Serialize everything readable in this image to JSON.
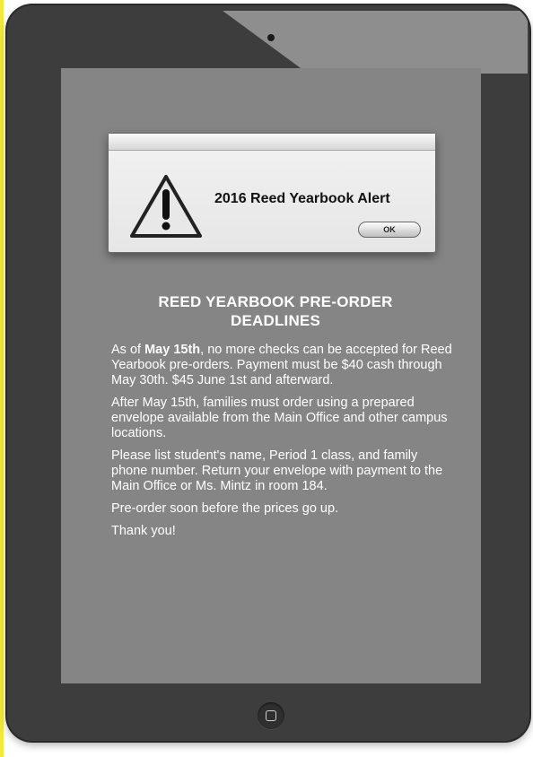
{
  "dialog": {
    "icon": "warning-triangle-icon",
    "title": "2016 Reed Yearbook Alert",
    "ok_label": "OK"
  },
  "notice": {
    "heading_line1": "REED YEARBOOK PRE-ORDER",
    "heading_line2": "DEADLINES",
    "p1_prefix": "As of ",
    "p1_date": "May 15th",
    "p1_rest": ", no more checks can be accepted for Reed Yearbook pre-orders. Payment must be $40 cash through May 30th. $45 June 1st and afterward.",
    "p2": "After May 15th, families must order using a prepared envelope available from the Main Office and other campus locations.",
    "p3": "Please list student's name, Period 1 class, and family phone number.  Return your envelope with payment to the Main Office or Ms. Mintz in room 184.",
    "p4": "Pre-order soon before the prices go up.",
    "p5": "Thank you!"
  },
  "device": {
    "camera_icon": "camera-dot-icon",
    "home_icon": "home-button-icon"
  }
}
